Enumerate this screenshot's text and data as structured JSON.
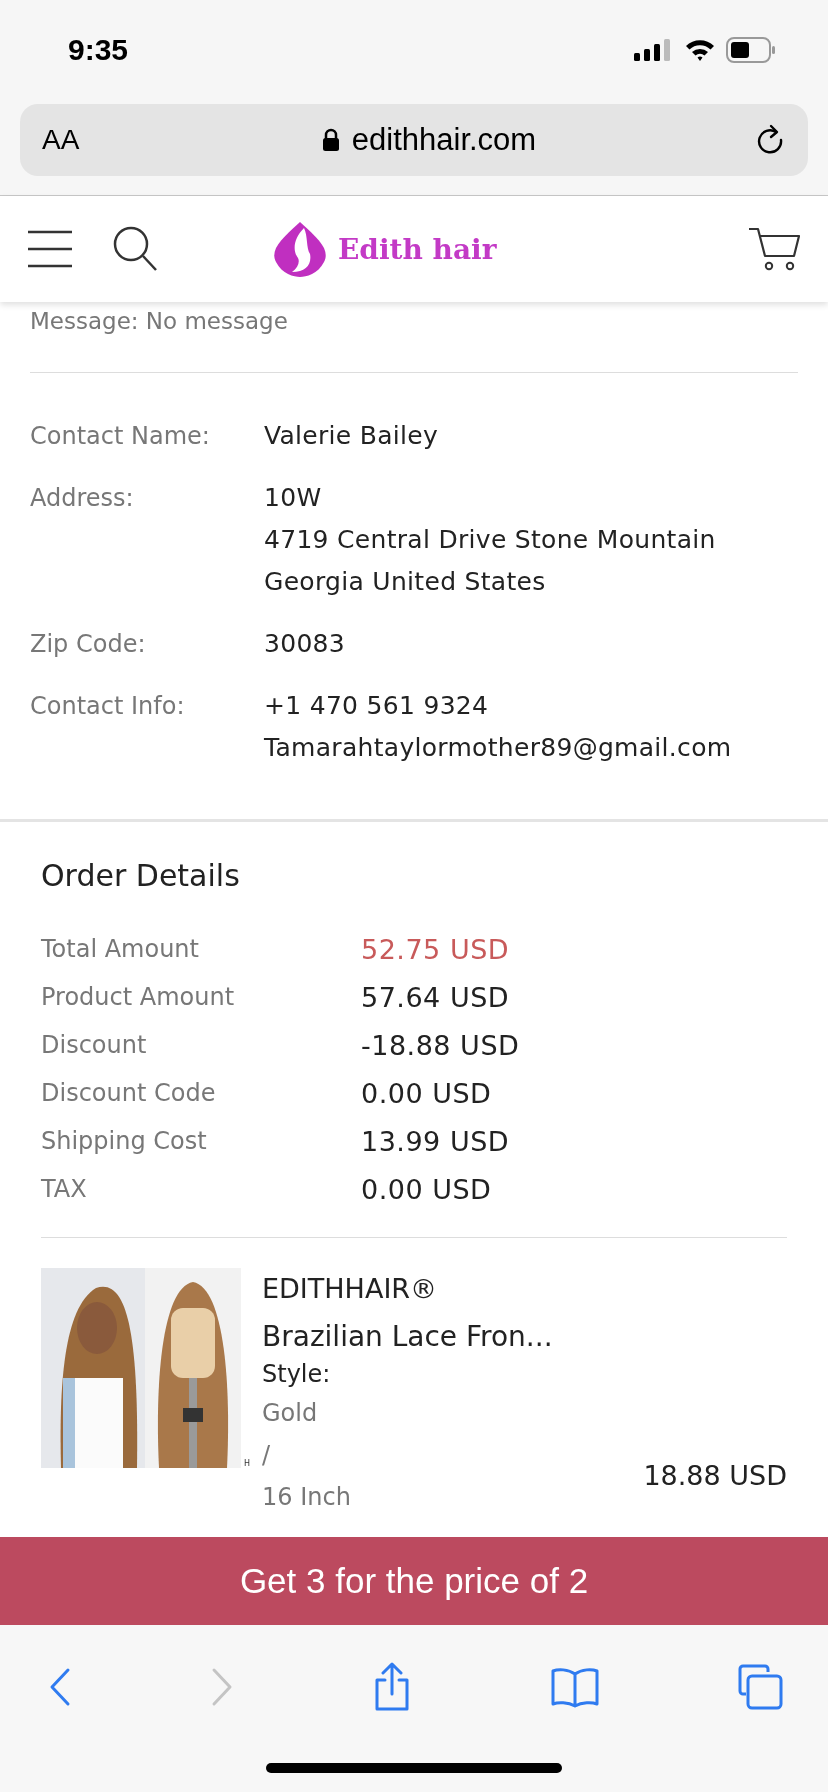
{
  "status_bar": {
    "time": "9:35"
  },
  "browser": {
    "text_size_button": "AA",
    "url": "edithhair.com"
  },
  "site_header": {
    "logo_text": "Edith hair"
  },
  "message": "Message: No message",
  "contact": [
    {
      "label": "Contact Name:",
      "lines": [
        "Valerie Bailey"
      ]
    },
    {
      "label": "Address:",
      "lines": [
        "10W",
        "4719 Central Drive Stone Mountain",
        "Georgia United States"
      ]
    },
    {
      "label": "Zip Code:",
      "lines": [
        "30083"
      ]
    },
    {
      "label": "Contact Info:",
      "lines": [
        "+1 470 561 9324",
        "Tamarahtaylormother89@gmail.com"
      ]
    }
  ],
  "order_details": {
    "title": "Order Details",
    "rows": [
      {
        "label": "Total Amount",
        "value": "52.75 USD",
        "emphasized": true
      },
      {
        "label": "Product Amount",
        "value": "57.64 USD",
        "emphasized": false
      },
      {
        "label": "Discount",
        "value": "-18.88 USD",
        "emphasized": false
      },
      {
        "label": "Discount Code",
        "value": "0.00 USD",
        "emphasized": false
      },
      {
        "label": "Shipping Cost",
        "value": "13.99 USD",
        "emphasized": false
      },
      {
        "label": "TAX",
        "value": "0.00 USD",
        "emphasized": false
      }
    ]
  },
  "product": {
    "image": {
      "kind": "picture"
    },
    "image_mark": "H",
    "brand": "EDITHHAIR®",
    "name": "Brazilian Lace Fron...",
    "style_label": "Style:",
    "options": [
      "Gold",
      "/",
      "16 Inch"
    ],
    "price": "18.88 USD"
  },
  "banner": "Get 3 for the price of 2",
  "toolbar": [
    {
      "kind": "back",
      "disabled": false
    },
    {
      "kind": "forward",
      "disabled": true
    },
    {
      "kind": "share",
      "disabled": false
    },
    {
      "kind": "bookmarks",
      "disabled": false
    },
    {
      "kind": "tabs",
      "disabled": false
    }
  ]
}
